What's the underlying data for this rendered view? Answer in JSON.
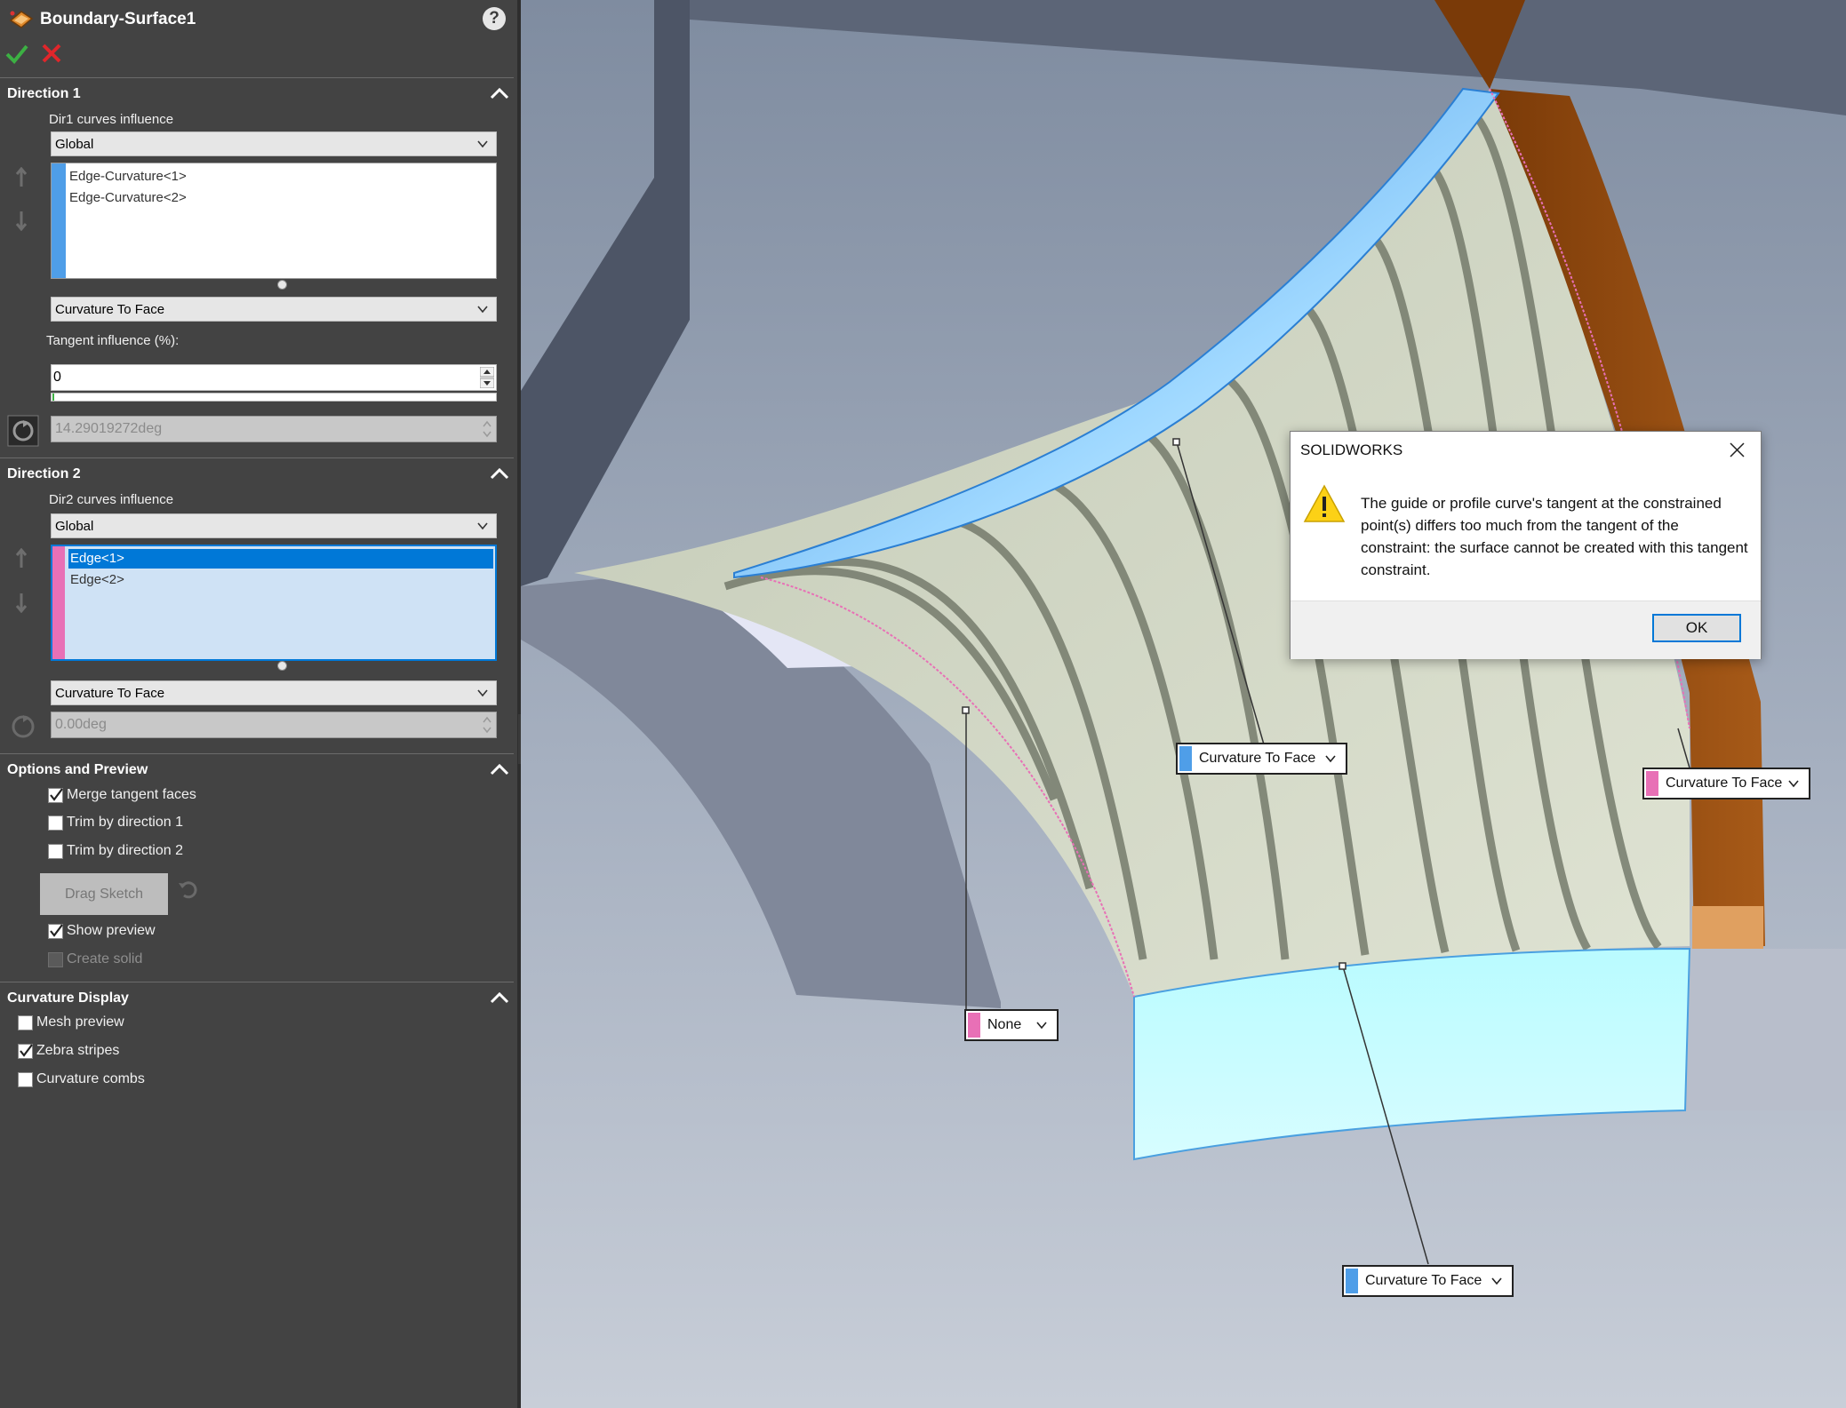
{
  "feature": {
    "title": "Boundary-Surface1",
    "help_label": "?"
  },
  "direction1": {
    "header": "Direction 1",
    "influence_label": "Dir1 curves influence",
    "influence_value": "Global",
    "curves": [
      "Edge-Curvature<1>",
      "Edge-Curvature<2>"
    ],
    "strip_color": "#4f9ee8",
    "condition_value": "Curvature To Face",
    "tangent_label": "Tangent influence (%):",
    "tangent_value": "0",
    "angle_value": "14.29019272deg"
  },
  "direction2": {
    "header": "Direction 2",
    "influence_label": "Dir2 curves influence",
    "influence_value": "Global",
    "curves": [
      "Edge<1>",
      "Edge<2>"
    ],
    "strip_color": "#e870b6",
    "condition_value": "Curvature To Face",
    "angle_value": "0.00deg"
  },
  "options": {
    "header": "Options and Preview",
    "merge_tangent_faces": {
      "label": "Merge tangent faces",
      "checked": true
    },
    "trim_dir1": {
      "label": "Trim by direction 1",
      "checked": false
    },
    "trim_dir2": {
      "label": "Trim by direction 2",
      "checked": false
    },
    "drag_sketch": "Drag Sketch",
    "show_preview": {
      "label": "Show preview",
      "checked": true
    },
    "create_solid": {
      "label": "Create solid",
      "checked": false
    }
  },
  "curvature_display": {
    "header": "Curvature Display",
    "mesh_preview": {
      "label": "Mesh preview",
      "checked": false
    },
    "zebra_stripes": {
      "label": "Zebra stripes",
      "checked": true
    },
    "curvature_combs": {
      "label": "Curvature combs",
      "checked": false
    }
  },
  "callouts": {
    "top_center": "Curvature To Face",
    "right": "Curvature To Face",
    "left": "None",
    "bottom": "Curvature To Face"
  },
  "dialog": {
    "title": "SOLIDWORKS",
    "message": "The guide or profile curve's tangent at the constrained point(s) differs too much from the tangent of the constraint: the surface cannot be created with this tangent constraint.",
    "ok_label": "OK"
  },
  "colors": {
    "panel_bg": "#434343",
    "dir1_strip": "#4f9ee8",
    "dir2_strip": "#e870b6",
    "selection": "#0078d7",
    "accent_orange": "#8b4513"
  }
}
